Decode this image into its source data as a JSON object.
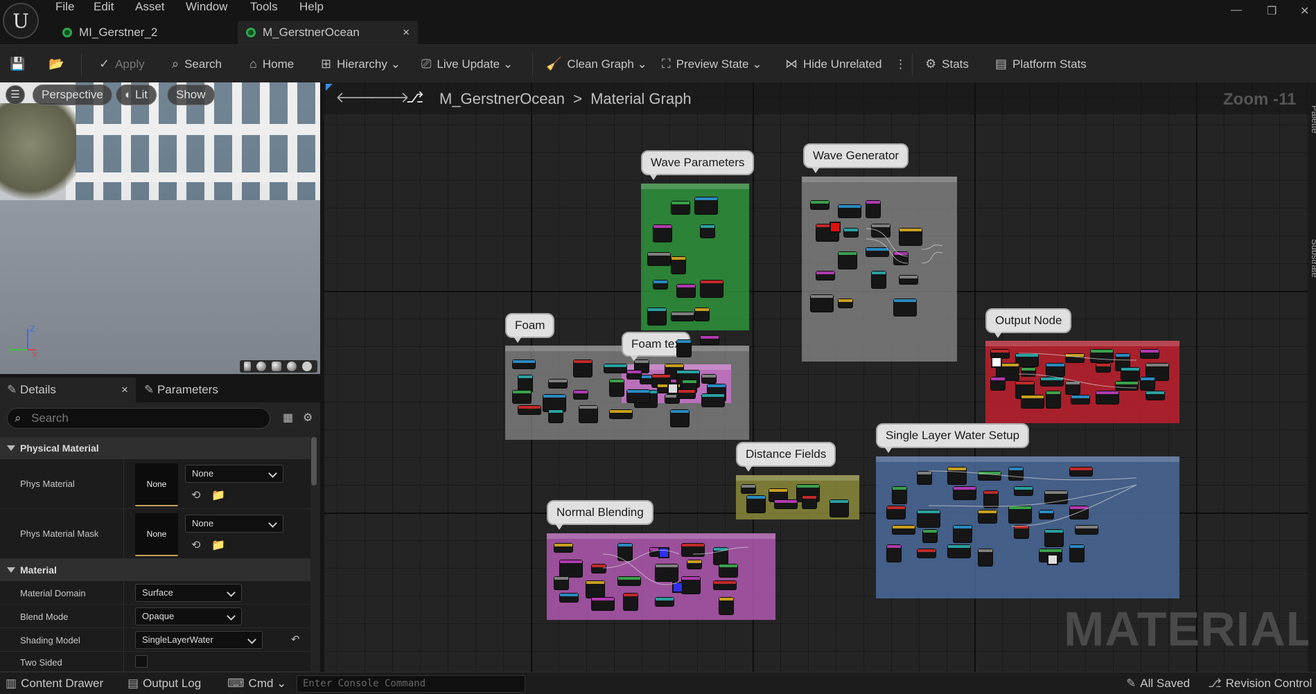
{
  "menu": {
    "items": [
      "File",
      "Edit",
      "Asset",
      "Window",
      "Tools",
      "Help"
    ]
  },
  "tabs": [
    {
      "label": "MI_Gerstner_2"
    },
    {
      "label": "M_GerstnerOcean",
      "close": "×"
    }
  ],
  "toolbar": {
    "apply": "Apply",
    "search": "Search",
    "home": "Home",
    "hierarchy": "Hierarchy",
    "live_update": "Live Update",
    "clean_graph": "Clean Graph",
    "preview_state": "Preview State",
    "hide_unrelated": "Hide Unrelated",
    "stats": "Stats",
    "platform_stats": "Platform Stats"
  },
  "viewport": {
    "perspective": "Perspective",
    "lit": "Lit",
    "show": "Show",
    "axis_z": "Z",
    "axis_y": "Y",
    "axis_x": "X"
  },
  "details": {
    "tab_details": "Details",
    "tab_parameters": "Parameters",
    "close": "×",
    "search_placeholder": "Search",
    "categories": [
      {
        "label": "Physical Material"
      },
      {
        "label": "Material"
      }
    ],
    "properties": [
      {
        "label": "Phys Material",
        "thumb": "None",
        "value": "None"
      },
      {
        "label": "Phys Material Mask",
        "thumb": "None",
        "value": "None"
      },
      {
        "label": "Material Domain",
        "value": "Surface"
      },
      {
        "label": "Blend Mode",
        "value": "Opaque"
      },
      {
        "label": "Shading Model",
        "value": "SingleLayerWater"
      },
      {
        "label": "Two Sided",
        "value": ""
      }
    ]
  },
  "graph": {
    "breadcrumb_asset": "M_GerstnerOcean",
    "breadcrumb_sep": ">",
    "breadcrumb_graph": "Material Graph",
    "zoom": "Zoom -11",
    "watermark": "MATERIAL",
    "comments": [
      {
        "title": "Wave Parameters",
        "color": "#2e9a3c"
      },
      {
        "title": "Wave Generator",
        "color": "#8a8a8a"
      },
      {
        "title": "Foam",
        "color": "#8a8a8a"
      },
      {
        "title": "Foam tex",
        "color": "#c870c8"
      },
      {
        "title": "Output Node",
        "color": "#c0202e"
      },
      {
        "title": "Single Layer Water Setup",
        "color": "#4a6a9a"
      },
      {
        "title": "Distance Fields",
        "color": "#8a8a3a"
      },
      {
        "title": "Normal Blending",
        "color": "#b058b0"
      }
    ]
  },
  "side_panels": {
    "palette": "Palette",
    "substrate": "Substrate"
  },
  "bottom": {
    "content_drawer": "Content Drawer",
    "output_log": "Output Log",
    "cmd": "Cmd",
    "console_placeholder": "Enter Console Command",
    "all_saved": "All Saved",
    "revision_control": "Revision Control"
  }
}
